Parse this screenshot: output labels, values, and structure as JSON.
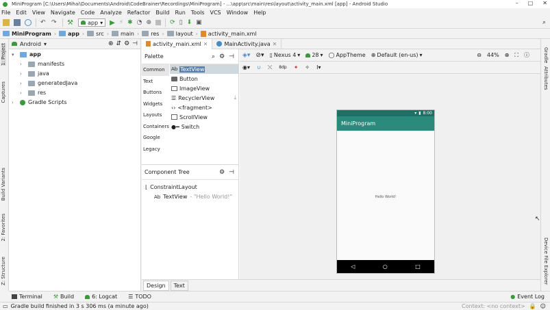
{
  "window": {
    "title": "MiniProgram [C:\\Users\\Mihai\\Documents\\Android\\CodeBrainer\\Recordings\\MiniProgram] - ...\\app\\src\\main\\res\\layout\\activity_main.xml [app] - Android Studio",
    "minimize": "–",
    "maximize": "□",
    "close": "✕"
  },
  "menu": [
    "File",
    "Edit",
    "View",
    "Navigate",
    "Code",
    "Analyze",
    "Refactor",
    "Build",
    "Run",
    "Tools",
    "VCS",
    "Window",
    "Help"
  ],
  "toolbar": {
    "run_config": "app"
  },
  "breadcrumb": [
    "MiniProgram",
    "app",
    "src",
    "main",
    "res",
    "layout",
    "activity_main.xml"
  ],
  "project": {
    "view_selector": "Android",
    "tree": [
      {
        "label": "app",
        "level": 0,
        "expanded": true
      },
      {
        "label": "manifests",
        "level": 1,
        "expanded": false
      },
      {
        "label": "java",
        "level": 1,
        "expanded": false
      },
      {
        "label": "generatedJava",
        "level": 1,
        "expanded": false
      },
      {
        "label": "res",
        "level": 1,
        "expanded": false
      },
      {
        "label": "Gradle Scripts",
        "level": 0,
        "expanded": false
      }
    ]
  },
  "left_tool_tabs": [
    "1: Project",
    "Captures",
    "Build Variants",
    "2: Favorites",
    "Z: Structure"
  ],
  "right_tool_tabs": [
    "Gradle",
    "Attributes",
    "Device File Explorer"
  ],
  "editor_tabs": [
    {
      "label": "activity_main.xml",
      "active": true
    },
    {
      "label": "MainActivity.java",
      "active": false
    }
  ],
  "palette": {
    "title": "Palette",
    "categories": [
      "Common",
      "Text",
      "Buttons",
      "Widgets",
      "Layouts",
      "Containers",
      "Google",
      "Legacy"
    ],
    "items": [
      "TextView",
      "Button",
      "ImageView",
      "RecyclerView",
      "<fragment>",
      "ScrollView",
      "Switch"
    ],
    "textview_prefix": "Ab"
  },
  "component_tree": {
    "title": "Component Tree",
    "root": "ConstraintLayout",
    "child_prefix": "Ab",
    "child": "TextView",
    "child_hint": "- \"Hello World!\""
  },
  "design_toolbar": {
    "device": "Nexus 4",
    "api": "28",
    "theme": "AppTheme",
    "locale": "Default (en-us)",
    "zoom": "44%",
    "margin_value": "8dp"
  },
  "phone": {
    "time": "8:00",
    "app_title": "MiniProgram",
    "content_text": "Hello World!",
    "nav_back": "◁",
    "nav_home": "○",
    "nav_recent": "□"
  },
  "editor_bottom_tabs": [
    {
      "label": "Design",
      "active": true
    },
    {
      "label": "Text",
      "active": false
    }
  ],
  "tool_windows": [
    "Terminal",
    "Build",
    "6: Logcat",
    "TODO"
  ],
  "event_log": "Event Log",
  "status": {
    "message": "Gradle build finished in 3 s 306 ms (a minute ago)",
    "context": "Context: <no context>"
  },
  "colors": {
    "app_bar": "#2a8a7c",
    "status_bar": "#1e6f64",
    "run_green": "#3a9a3a"
  }
}
